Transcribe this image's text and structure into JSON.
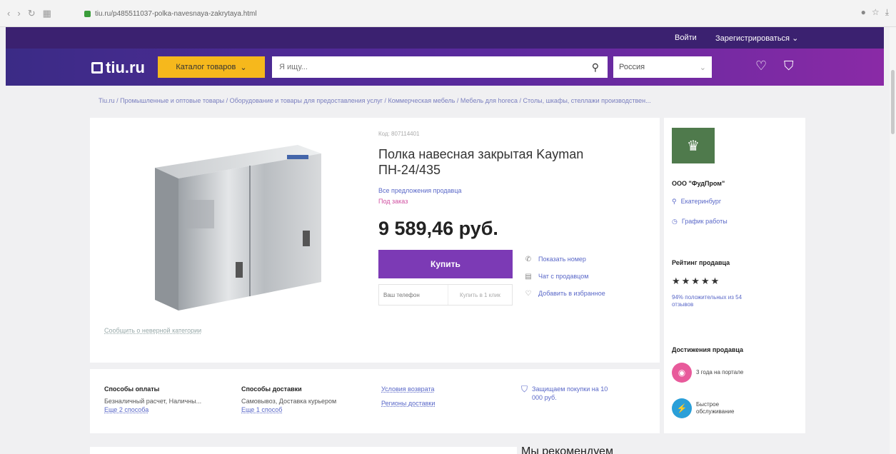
{
  "browser": {
    "url": "tiu.ru/p485511037-polka-navesnaya-zakrytaya.html"
  },
  "userbar": {
    "login": "Войти",
    "register": "Зарегистрироваться"
  },
  "header": {
    "logo": "tiu.ru",
    "catalog_button": "Каталог товаров",
    "search_placeholder": "Я ищу...",
    "region": "Россия"
  },
  "breadcrumb": "Tiu.ru / Промышленные и оптовые товары / Оборудование и товары для предоставления услуг / Коммерческая мебель / Мебель для horeca / Столы, шкафы, стеллажи производствен...",
  "product": {
    "sku": "Код: 807114401",
    "title": "Полка навесная закрытая Kayman ПН-24/435",
    "seller_offers": "Все предложения продавца",
    "status": "Под заказ",
    "price": "9 589,46 руб.",
    "buy_label": "Купить",
    "phone_placeholder": "Ваш телефон",
    "oneclick_label": "Купить в 1 клик",
    "report_link": "Сообщить о неверной категории",
    "actions": [
      {
        "icon": "phone-icon",
        "label": "Показать номер"
      },
      {
        "icon": "chat-icon",
        "label": "Чат с продавцом"
      },
      {
        "icon": "heart-icon",
        "label": "Добавить в избранное"
      }
    ]
  },
  "info": {
    "payment": {
      "title": "Способы оплаты",
      "text": "Безналичный расчет, Наличны...",
      "more": "Еще 2 способа"
    },
    "delivery": {
      "title": "Способы доставки",
      "text": "Самовывоз, Доставка курьером",
      "more": "Еще 1 способ"
    },
    "links": [
      "Условия возврата",
      "Регионы доставки"
    ],
    "protection": "Защищаем покупки на 10 000 руб."
  },
  "seller": {
    "name": "ООО \"ФудПром\"",
    "city": "Екатеринбург",
    "schedule": "График работы",
    "rating_title": "Рейтинг продавца",
    "stars": "★★★★★",
    "rating_text": "94% положительных из 54 отзывов",
    "achievements_title": "Достижения продавца",
    "achievements": [
      {
        "text": "3 года на портале",
        "color": "#e85a9b"
      },
      {
        "text": "Быстрое обслуживание",
        "color": "#2a9fd8"
      }
    ]
  },
  "recommend_heading": "Мы рекомендуем"
}
